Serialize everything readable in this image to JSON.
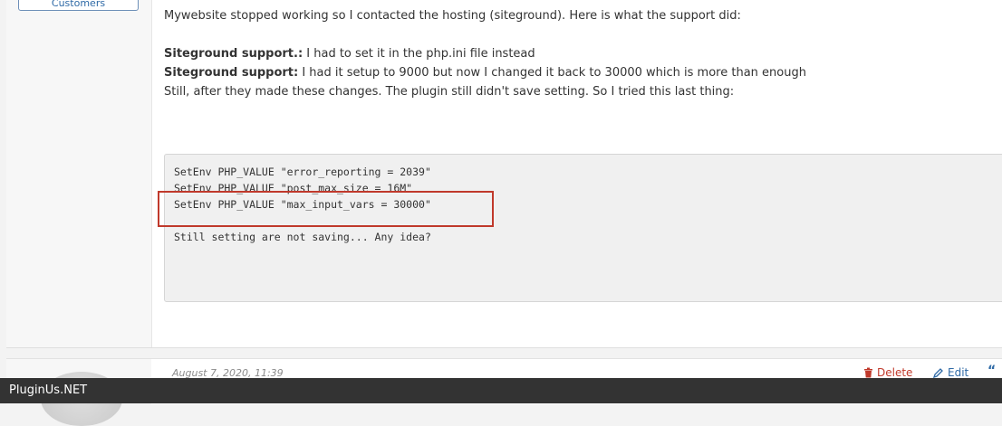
{
  "author": {
    "role_badge": "Customers"
  },
  "post": {
    "intro": "Mywebsite stopped working so I contacted the hosting (siteground). Here is what the support did:",
    "support_lines": [
      {
        "label": "Siteground support.:",
        "text": " I had to set it in the php.ini file instead"
      },
      {
        "label": "Siteground support:",
        "text": " I had it setup to 9000 but now I changed it back to 30000 which is more than enough"
      }
    ],
    "followup": "Still, after they made these changes. The plugin still didn't save setting. So I tried this last thing:",
    "code_lines": [
      "SetEnv PHP_VALUE \"error_reporting = 2039\"",
      "SetEnv PHP_VALUE \"post_max_size = 16M\"",
      "SetEnv PHP_VALUE \"max_input_vars = 30000\"",
      "",
      "Still setting are not saving... Any idea?"
    ]
  },
  "next_post": {
    "date": "August 7, 2020, 11:39",
    "delete_label": "Delete",
    "edit_label": "Edit",
    "quote_glyph": "“"
  },
  "footer": {
    "brand": "PluginUs.NET"
  },
  "colors": {
    "delete": "#c0392b",
    "link": "#2f6aa6",
    "highlight": "#c0392b",
    "footer_bg": "#333333"
  }
}
